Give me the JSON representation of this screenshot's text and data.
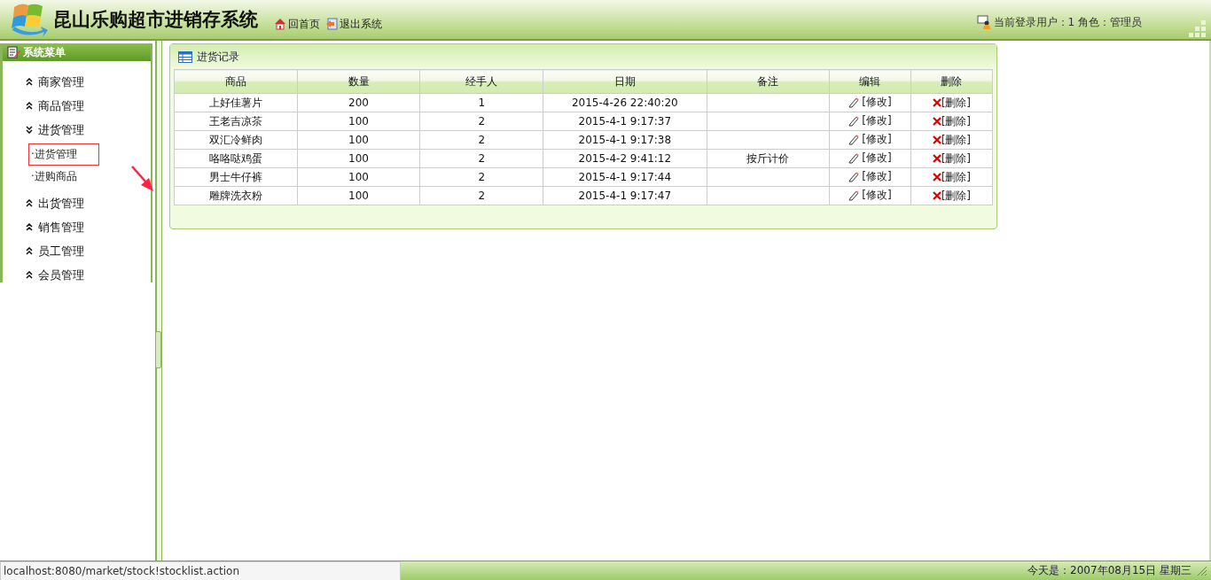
{
  "header": {
    "title": "昆山乐购超市进销存系统",
    "links": [
      {
        "label": "回首页",
        "kind": "home"
      },
      {
        "label": "退出系统",
        "kind": "exit"
      }
    ],
    "user_info": "当前登录用户：1 角色：管理员"
  },
  "sidebar": {
    "title": "系统菜单",
    "items": [
      {
        "label": "商家管理",
        "expanded": false
      },
      {
        "label": "商品管理",
        "expanded": false
      },
      {
        "label": "进货管理",
        "expanded": true,
        "children": [
          {
            "label": "·进货管理",
            "highlighted": true
          },
          {
            "label": "·进购商品",
            "highlighted": false
          }
        ]
      },
      {
        "label": "出货管理",
        "expanded": false
      },
      {
        "label": "销售管理",
        "expanded": false
      },
      {
        "label": "员工管理",
        "expanded": false
      },
      {
        "label": "会员管理",
        "expanded": false
      }
    ]
  },
  "panel": {
    "title": "进货记录",
    "table": {
      "columns": [
        "商品",
        "数量",
        "经手人",
        "日期",
        "备注",
        "编辑",
        "删除"
      ],
      "rows": [
        {
          "cells": [
            "上好佳薯片",
            "200",
            "1",
            "2015-4-26 22:40:20",
            ""
          ],
          "edit": "[修改]",
          "delete": "[删除]"
        },
        {
          "cells": [
            "王老吉凉茶",
            "100",
            "2",
            "2015-4-1 9:17:37",
            ""
          ],
          "edit": "[修改]",
          "delete": "[删除]"
        },
        {
          "cells": [
            "双汇冷鲜肉",
            "100",
            "2",
            "2015-4-1 9:17:38",
            ""
          ],
          "edit": "[修改]",
          "delete": "[删除]"
        },
        {
          "cells": [
            "咯咯哒鸡蛋",
            "100",
            "2",
            "2015-4-2 9:41:12",
            "按斤计价"
          ],
          "edit": "[修改]",
          "delete": "[删除]"
        },
        {
          "cells": [
            "男士牛仔裤",
            "100",
            "2",
            "2015-4-1 9:17:44",
            ""
          ],
          "edit": "[修改]",
          "delete": "[删除]"
        },
        {
          "cells": [
            "雕牌洗衣粉",
            "100",
            "2",
            "2015-4-1 9:17:47",
            ""
          ],
          "edit": "[修改]",
          "delete": "[删除]"
        }
      ]
    }
  },
  "status_url": "localhost:8080/market/stock!stocklist.action",
  "footer": {
    "date": "今天是：2007年08月15日 星期三"
  }
}
